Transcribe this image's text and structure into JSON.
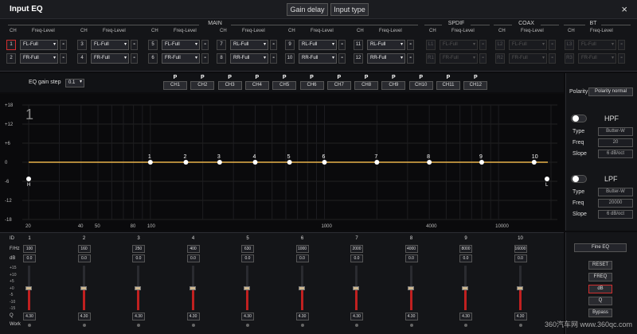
{
  "window": {
    "title": "Input EQ",
    "gain_delay": "Gain delay",
    "input_type": "Input type",
    "close": "×"
  },
  "groups": {
    "main": "MAIN",
    "spdif": "SPDIF",
    "coax": "COAX",
    "bt": "BT"
  },
  "headers": {
    "ch": "CH",
    "freq_level": "Freq-Level"
  },
  "main_channels": [
    {
      "n": "1",
      "v": "FL-Full"
    },
    {
      "n": "2",
      "v": "FR-Full"
    },
    {
      "n": "3",
      "v": "FL-Full"
    },
    {
      "n": "4",
      "v": "FR-Full"
    },
    {
      "n": "5",
      "v": "FL-Full"
    },
    {
      "n": "6",
      "v": "FR-Full"
    },
    {
      "n": "7",
      "v": "RL-Full"
    },
    {
      "n": "8",
      "v": "RR-Full"
    },
    {
      "n": "9",
      "v": "RL-Full"
    },
    {
      "n": "10",
      "v": "RR-Full"
    },
    {
      "n": "11",
      "v": "RL-Full"
    },
    {
      "n": "12",
      "v": "RR-Full"
    }
  ],
  "spdif_channels": [
    {
      "n": "L1",
      "v": "FL-Full"
    },
    {
      "n": "R1",
      "v": "FR-Full"
    }
  ],
  "coax_channels": [
    {
      "n": "L2",
      "v": "FL-Full"
    },
    {
      "n": "R2",
      "v": "FR-Full"
    }
  ],
  "bt_channels": [
    {
      "n": "L3",
      "v": "FL-Full"
    },
    {
      "n": "R3",
      "v": "FR-Full"
    }
  ],
  "eq_gain_step": {
    "label": "EQ gain step",
    "value": "0.1"
  },
  "polarity_channels": {
    "p": "P",
    "labels": [
      "CH1",
      "CH2",
      "CH3",
      "CH4",
      "CH5",
      "CH6",
      "CH7",
      "CH8",
      "CH9",
      "CH10",
      "CH11",
      "CH12"
    ]
  },
  "graph": {
    "channel_indicator": "1",
    "y_ticks": [
      "+18",
      "+12",
      "+6",
      "0",
      "-6",
      "-12",
      "-18"
    ],
    "x_ticks": [
      "20",
      "40",
      "50",
      "80",
      "100",
      "1000",
      "4000",
      "10000"
    ],
    "band_labels": [
      "1",
      "2",
      "3",
      "4",
      "5",
      "6",
      "7",
      "8",
      "9",
      "10"
    ],
    "hpf_marker": "H",
    "lpf_marker": "L",
    "curve_color": "#e8b24a"
  },
  "right": {
    "polarity_label": "Polarity",
    "polarity_value": "Polarity normal",
    "hpf": {
      "title": "HPF",
      "type_label": "Type",
      "type": "Butter-W",
      "freq_label": "Freq",
      "freq": "20",
      "slope_label": "Slope",
      "slope": "6 dB/oct"
    },
    "lpf": {
      "title": "LPF",
      "type_label": "Type",
      "type": "Butter-W",
      "freq_label": "Freq",
      "freq": "20000",
      "slope_label": "Slope",
      "slope": "6 dB/oct"
    }
  },
  "bands": {
    "row_labels": {
      "id": "ID",
      "freq": "F/Hz",
      "db": "dB",
      "q": "Q",
      "work": "Work"
    },
    "db_scale": [
      "+15",
      "+10",
      "+5",
      "+0",
      "-5",
      "-10",
      "-15"
    ],
    "items": [
      {
        "id": "1",
        "freq": "100",
        "db": "0.0",
        "q": "4.30"
      },
      {
        "id": "2",
        "freq": "160",
        "db": "0.0",
        "q": "4.30"
      },
      {
        "id": "3",
        "freq": "250",
        "db": "0.0",
        "q": "4.30"
      },
      {
        "id": "4",
        "freq": "400",
        "db": "0.0",
        "q": "4.30"
      },
      {
        "id": "5",
        "freq": "630",
        "db": "0.0",
        "q": "4.30"
      },
      {
        "id": "6",
        "freq": "1000",
        "db": "0.0",
        "q": "4.30"
      },
      {
        "id": "7",
        "freq": "2000",
        "db": "0.0",
        "q": "4.30"
      },
      {
        "id": "8",
        "freq": "4000",
        "db": "0.0",
        "q": "4.30"
      },
      {
        "id": "9",
        "freq": "8000",
        "db": "0.0",
        "q": "4.30"
      },
      {
        "id": "10",
        "freq": "16000",
        "db": "0.0",
        "q": "4.30"
      }
    ]
  },
  "bottom_right": {
    "mode": "Fine EQ",
    "reset": "RESET",
    "freq": "FREQ",
    "db": "dB",
    "q": "Q",
    "bypass": "Bypass"
  },
  "watermark": "360汽车网 www.360qc.com",
  "colors": {
    "accent": "#d12f2f",
    "curve": "#e8b24a",
    "bg": "#0c0c0e"
  }
}
